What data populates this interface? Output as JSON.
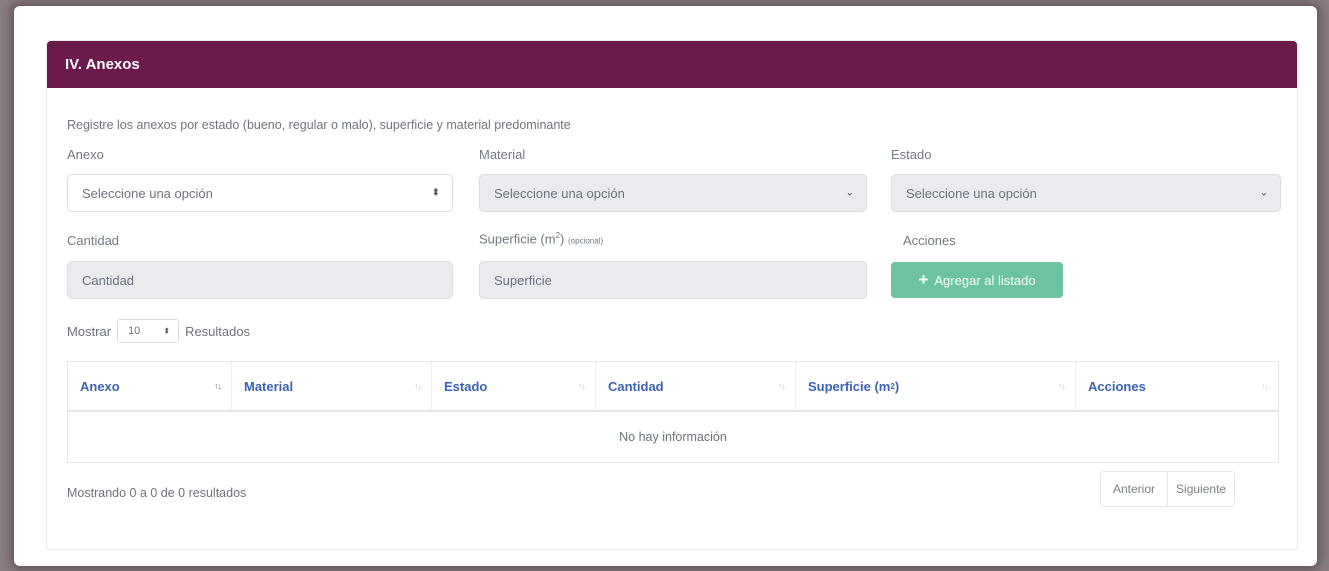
{
  "section": {
    "title": "IV. Anexos"
  },
  "intro_text": "Registre los anexos por estado (bueno, regular o malo), superficie y material predominante",
  "form": {
    "anexo": {
      "label": "Anexo",
      "value": "Seleccione una opción"
    },
    "material": {
      "label": "Material",
      "value": "Seleccione una opción"
    },
    "estado": {
      "label": "Estado",
      "value": "Seleccione una opción"
    },
    "cantidad": {
      "label": "Cantidad",
      "placeholder": "Cantidad"
    },
    "superficie": {
      "label": "Superficie (m",
      "label_sup": "2",
      "label_close": ")",
      "optional": "(opcional)",
      "placeholder": "Superficie"
    },
    "acciones": {
      "label": "Acciones"
    },
    "add_button": {
      "label": "Agregar al listado",
      "icon": "plus-icon"
    },
    "colors": {
      "header_bg": "#6b1a4a",
      "add_button_bg": "#6cc3a0",
      "link_header": "#3b63b4"
    }
  },
  "table_length": {
    "prefix": "Mostrar",
    "value": "10",
    "suffix": "Resultados"
  },
  "table": {
    "columns": [
      {
        "label": "Anexo"
      },
      {
        "label": "Material"
      },
      {
        "label": "Estado"
      },
      {
        "label": "Cantidad"
      },
      {
        "label": "Superficie (m",
        "sup": "2",
        "close": ")"
      },
      {
        "label": "Acciones"
      }
    ],
    "empty_message": "No hay información"
  },
  "footer": {
    "info": "Mostrando 0 a 0 de 0 resultados",
    "prev": "Anterior",
    "next": "Siguiente"
  }
}
